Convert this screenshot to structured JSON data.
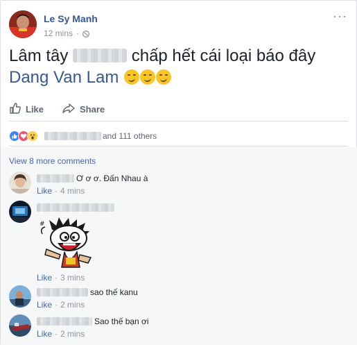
{
  "post": {
    "author": "Le Sy Manh",
    "time": "12 mins",
    "separator": "·",
    "more_label": "···",
    "text_part1": "Lâm tây",
    "text_part2": "chấp hết cái loại báo đây",
    "mention": "Dang Van Lam"
  },
  "actions": {
    "like_label": "Like",
    "share_label": "Share"
  },
  "reactions": {
    "others_text": "and 111 others",
    "types": [
      "like-icon",
      "love-icon",
      "wow-icon"
    ],
    "colors": {
      "like": "#3b86f7",
      "love": "#f2526e",
      "wow": "#fcd14b"
    }
  },
  "comments": {
    "view_more": "View 8 more comments",
    "items": [
      {
        "text": "Ơ ơ ơ. Đấn Nhau à",
        "like": "Like",
        "sep": "·",
        "time": "4 mins"
      },
      {
        "text": "",
        "like": "Like",
        "sep": "·",
        "time": "3 mins"
      },
      {
        "text": "sao thế kanu",
        "like": "Like",
        "sep": "·",
        "time": "2 mins"
      },
      {
        "text": "Sao thế bạn ơi",
        "like": "Like",
        "sep": "·",
        "time": "2 mins"
      }
    ]
  },
  "colors": {
    "link": "#365899",
    "meta": "#90949c",
    "comment_bg": "#f6f7f9"
  }
}
